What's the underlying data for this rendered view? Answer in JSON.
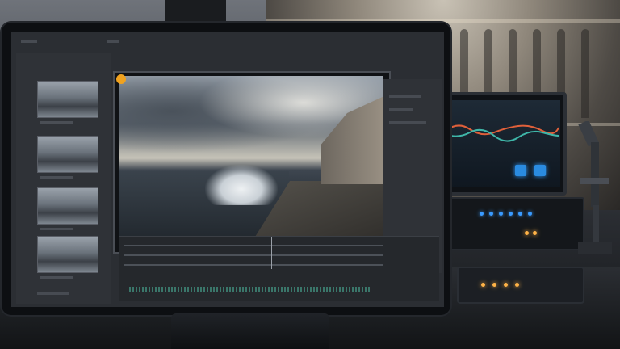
{
  "scene": {
    "description_free": true,
    "colors": {
      "accent": "#f0a21f",
      "screen_glow": "#2f9bff",
      "led_warm": "#ffb347"
    }
  },
  "icons": {
    "app_badge": "circle-badge-icon"
  }
}
